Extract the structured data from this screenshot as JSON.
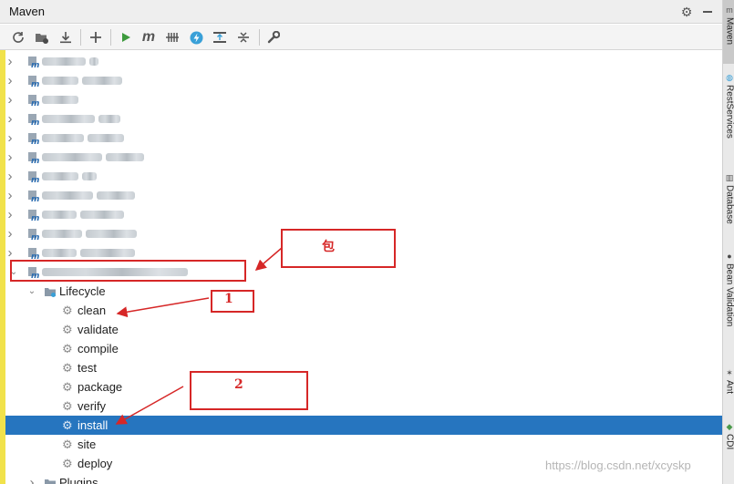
{
  "window": {
    "title": "Maven"
  },
  "toolbar": {
    "buttons": [
      {
        "name": "reimport-all-button",
        "icon": "refresh-icon"
      },
      {
        "name": "generate-sources-button",
        "icon": "folder-gear-icon"
      },
      {
        "name": "download-sources-button",
        "icon": "download-icon"
      },
      {
        "name": "add-project-button",
        "icon": "plus-icon"
      },
      {
        "name": "run-goal-button",
        "icon": "play-icon"
      },
      {
        "name": "execute-goal-button",
        "icon": "maven-m-icon"
      },
      {
        "name": "toggle-offline-button",
        "icon": "offline-icon"
      },
      {
        "name": "skip-tests-button",
        "icon": "lightning-icon"
      },
      {
        "name": "show-dependencies-button",
        "icon": "diagram-icon"
      },
      {
        "name": "collapse-all-button",
        "icon": "collapse-icon"
      },
      {
        "name": "maven-settings-button",
        "icon": "wrench-icon"
      }
    ],
    "m_glyph": "m"
  },
  "colors": {
    "selection": "#2675bf",
    "annotation": "#d62727",
    "gutter": "#f1e24b"
  },
  "tree": {
    "lifecycle": {
      "label": "Lifecycle",
      "phases": [
        "clean",
        "validate",
        "compile",
        "test",
        "package",
        "verify",
        "install",
        "site",
        "deploy"
      ],
      "selected": "install"
    },
    "plugins_label": "Plugins"
  },
  "right_stripe": [
    {
      "label": "Maven",
      "icon": "maven-icon"
    },
    {
      "label": "RestServices",
      "icon": "globe-icon"
    },
    {
      "label": "Database",
      "icon": "database-icon"
    },
    {
      "label": "Bean Validation",
      "icon": "bean-icon"
    },
    {
      "label": "Ant",
      "icon": "ant-icon"
    },
    {
      "label": "CDI",
      "icon": "cdi-icon"
    }
  ],
  "annotations": {
    "bao": "包",
    "one": "1",
    "two": "2"
  },
  "watermark": "https://blog.csdn.net/xcyskp"
}
